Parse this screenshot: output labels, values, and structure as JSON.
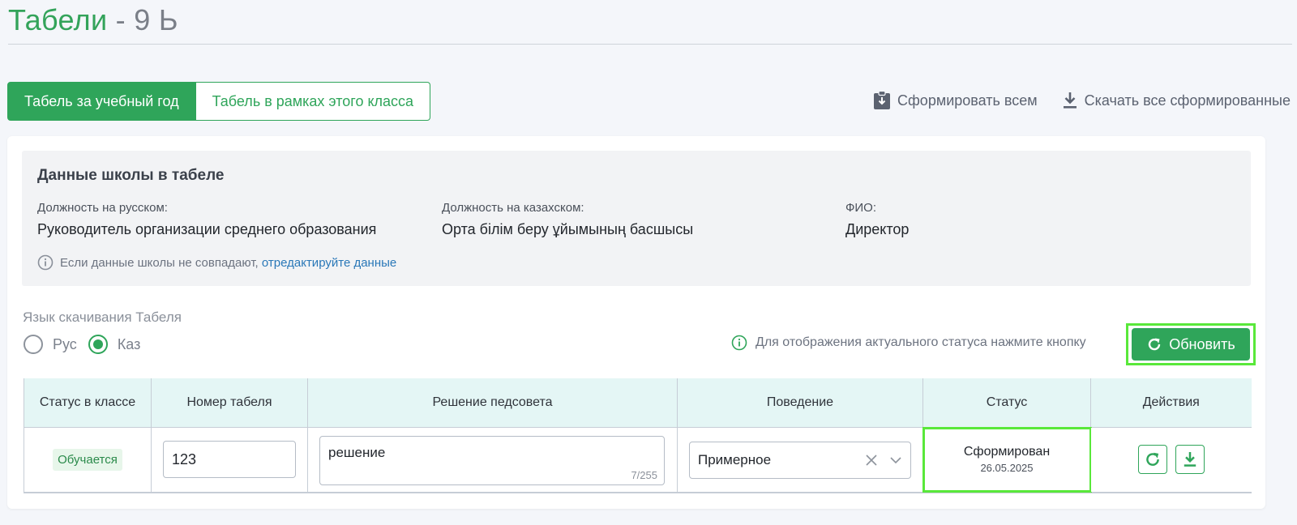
{
  "page": {
    "title_main": "Табели",
    "title_sep": " - ",
    "title_class": "9 Ь"
  },
  "tabs": [
    {
      "label": "Табель за учебный год",
      "active": true
    },
    {
      "label": "Табель в рамках этого класса",
      "active": false
    }
  ],
  "top_actions": {
    "generate_all": "Сформировать всем",
    "download_all": "Скачать все сформированные"
  },
  "school": {
    "title": "Данные школы в табеле",
    "position_ru_label": "Должность на русском:",
    "position_ru_value": "Руководитель организации среднего образования",
    "position_kz_label": "Должность на казахском:",
    "position_kz_value": "Орта білім беру ұйымының басшысы",
    "fio_label": "ФИО:",
    "fio_value": "Директор",
    "hint_text": "Если данные школы не совпадают,",
    "hint_link": "отредактируйте данные"
  },
  "language": {
    "label": "Язык скачивания Табеля",
    "options": [
      {
        "label": "Рус",
        "checked": false
      },
      {
        "label": "Каз",
        "checked": true
      }
    ]
  },
  "refresh": {
    "hint": "Для отображения актуального статуса нажмите кнопку",
    "button_label": "Обновить"
  },
  "table": {
    "headers": [
      "Статус в классе",
      "Номер табеля",
      "Решение педсовета",
      "Поведение",
      "Статус",
      "Действия"
    ],
    "row": {
      "class_status": "Обучается",
      "number": "123",
      "decision": "решение",
      "decision_count": "7/255",
      "behavior": "Примерное",
      "status": "Сформирован",
      "status_date": "26.05.2025"
    }
  },
  "colors": {
    "accent": "#2fa55a",
    "highlight": "#59e83a",
    "link": "#2a78b8"
  }
}
